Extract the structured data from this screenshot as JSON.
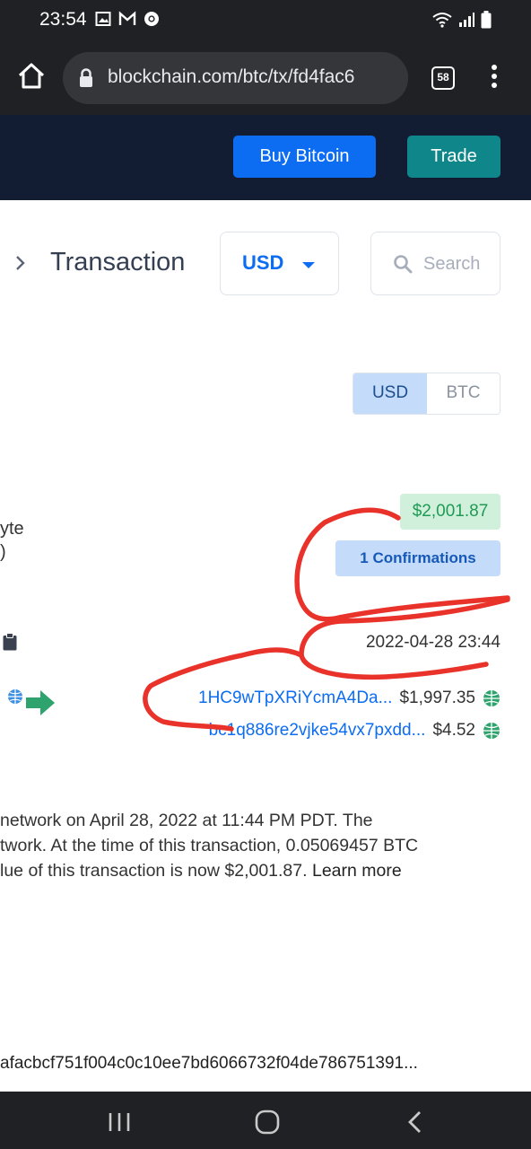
{
  "status_bar": {
    "time": "23:54",
    "left_icons": [
      "image-icon",
      "gmail-icon",
      "chrome-icon"
    ],
    "right_icons": [
      "wifi-icon",
      "signal-icon",
      "battery-icon"
    ]
  },
  "browser": {
    "url": "blockchain.com/btc/tx/fd4fac6",
    "tab_count": "58"
  },
  "header": {
    "buy_label": "Buy Bitcoin",
    "trade_label": "Trade",
    "buy_color": "#0c6cf2",
    "trade_color": "#0f868a",
    "background": "#121d33"
  },
  "page": {
    "title": "Transaction",
    "currency": "USD",
    "search_placeholder": "Search"
  },
  "toggle": {
    "usd_label": "USD",
    "btc_label": "BTC",
    "active": "USD"
  },
  "details": {
    "size_fragment": "yte",
    "paren_fragment": ")",
    "amount": "$2,001.87",
    "confirmations": "1 Confirmations",
    "timestamp": "2022-04-28 23:44"
  },
  "outputs": [
    {
      "address": "1HC9wTpXRiYcmA4Da...",
      "value": "$1,997.35"
    },
    {
      "address": "bc1q886re2vjke54vx7pxdd...",
      "value": "$4.52"
    }
  ],
  "description": {
    "line1": "network on April 28, 2022 at 11:44 PM PDT.  The",
    "line2": "twork.  At the time of this transaction, 0.05069457 BTC",
    "line3": "lue of this transaction is now $2,001.87.",
    "learn_more": "Learn more"
  },
  "hash_fragment": "afacbcf751f004c0c10ee7bd6066732f04de786751391...",
  "colors": {
    "annotation": "#e8322a",
    "link": "#0c6cf2",
    "amount_green": "#1f9a55",
    "arrow_green": "#2ea36d"
  }
}
